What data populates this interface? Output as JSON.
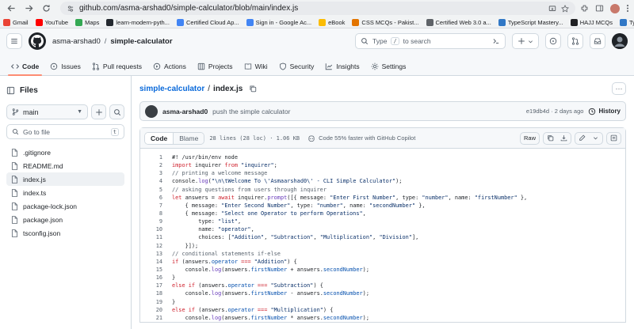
{
  "browser": {
    "url": "github.com/asma-arshad0/simple-calculator/blob/main/index.js",
    "bookmarks": [
      {
        "label": "Gmail",
        "color": "#ea4335"
      },
      {
        "label": "YouTube",
        "color": "#ff0000"
      },
      {
        "label": "Maps",
        "color": "#34a853"
      },
      {
        "label": "learn-modern-pyth...",
        "color": "#24292f"
      },
      {
        "label": "Certified Cloud Ap...",
        "color": "#4285f4"
      },
      {
        "label": "Sign in - Google Ac...",
        "color": "#4285f4"
      },
      {
        "label": "eBook",
        "color": "#fbbc04"
      },
      {
        "label": "CSS MCQs - Pakist...",
        "color": "#e37400"
      },
      {
        "label": "Certified Web 3.0 a...",
        "color": "#5f6368"
      },
      {
        "label": "TypeScript Mastery...",
        "color": "#3178c6"
      },
      {
        "label": "HAJJ MCQs",
        "color": "#202124"
      },
      {
        "label": "TypeScript Assign...",
        "color": "#3178c6"
      }
    ]
  },
  "header": {
    "owner": "asma-arshad0",
    "separator": "/",
    "repo": "simple-calculator",
    "search_placeholder_pre": "Type",
    "search_kbd": "/",
    "search_placeholder_post": "to search"
  },
  "tabs": [
    {
      "label": "Code",
      "icon": "code-icon",
      "active": true
    },
    {
      "label": "Issues",
      "icon": "issue-icon"
    },
    {
      "label": "Pull requests",
      "icon": "pull-request-icon"
    },
    {
      "label": "Actions",
      "icon": "play-icon"
    },
    {
      "label": "Projects",
      "icon": "table-icon"
    },
    {
      "label": "Wiki",
      "icon": "book-icon"
    },
    {
      "label": "Security",
      "icon": "shield-icon"
    },
    {
      "label": "Insights",
      "icon": "graph-icon"
    },
    {
      "label": "Settings",
      "icon": "gear-icon"
    }
  ],
  "sidebar": {
    "title": "Files",
    "branch": "main",
    "goto_placeholder": "Go to file",
    "goto_kbd": "t",
    "files": [
      {
        "name": ".gitignore"
      },
      {
        "name": "README.md"
      },
      {
        "name": "index.js",
        "active": true
      },
      {
        "name": "index.ts"
      },
      {
        "name": "package-lock.json"
      },
      {
        "name": "package.json"
      },
      {
        "name": "tsconfig.json"
      }
    ]
  },
  "file": {
    "repo_link": "simple-calculator",
    "sep": "/",
    "name": "index.js",
    "commit_user": "asma-arshad0",
    "commit_message": "push the simple calculator",
    "commit_meta": "e19db4d · 2 days ago",
    "history_label": "History",
    "tab_code": "Code",
    "tab_blame": "Blame",
    "info": "28 lines (28 loc) · 1.06 KB",
    "copilot": "Code 55% faster with GitHub Copilot",
    "raw_label": "Raw"
  },
  "code_lines": [
    [
      {
        "t": "#! /usr/bin/env node",
        "c": "src"
      }
    ],
    [
      {
        "t": "import",
        "c": "kw"
      },
      {
        "t": " inquirer ",
        "c": "src"
      },
      {
        "t": "from",
        "c": "kw"
      },
      {
        "t": " ",
        "c": "src"
      },
      {
        "t": "\"inquirer\"",
        "c": "str"
      },
      {
        "t": ";",
        "c": "src"
      }
    ],
    [
      {
        "t": "// printing a welcome message",
        "c": "com"
      }
    ],
    [
      {
        "t": "console.",
        "c": "src"
      },
      {
        "t": "log",
        "c": "fn"
      },
      {
        "t": "(",
        "c": "src"
      },
      {
        "t": "\"\\n\\tWelcome To \\'Asmaarshad0\\' - CLI Simple Calculator\"",
        "c": "str"
      },
      {
        "t": ");",
        "c": "src"
      }
    ],
    [
      {
        "t": "// asking questions from users through inquirer",
        "c": "com"
      }
    ],
    [
      {
        "t": "let",
        "c": "kw"
      },
      {
        "t": " answers = ",
        "c": "src"
      },
      {
        "t": "await",
        "c": "kw"
      },
      {
        "t": " inquirer.",
        "c": "src"
      },
      {
        "t": "prompt",
        "c": "fn"
      },
      {
        "t": "([{ message: ",
        "c": "src"
      },
      {
        "t": "\"Enter First Number\"",
        "c": "str"
      },
      {
        "t": ", type: ",
        "c": "src"
      },
      {
        "t": "\"number\"",
        "c": "str"
      },
      {
        "t": ", name: ",
        "c": "src"
      },
      {
        "t": "\"firstNumber\"",
        "c": "str"
      },
      {
        "t": " },",
        "c": "src"
      }
    ],
    [
      {
        "t": "    { message: ",
        "c": "src"
      },
      {
        "t": "\"Enter Second Number\"",
        "c": "str"
      },
      {
        "t": ", type: ",
        "c": "src"
      },
      {
        "t": "\"number\"",
        "c": "str"
      },
      {
        "t": ", name: ",
        "c": "src"
      },
      {
        "t": "\"secondNumber\"",
        "c": "str"
      },
      {
        "t": " },",
        "c": "src"
      }
    ],
    [
      {
        "t": "    { message: ",
        "c": "src"
      },
      {
        "t": "\"Select one Operator to perform Operations\"",
        "c": "str"
      },
      {
        "t": ",",
        "c": "src"
      }
    ],
    [
      {
        "t": "        type: ",
        "c": "src"
      },
      {
        "t": "\"list\"",
        "c": "str"
      },
      {
        "t": ",",
        "c": "src"
      }
    ],
    [
      {
        "t": "        name: ",
        "c": "src"
      },
      {
        "t": "\"operator\"",
        "c": "str"
      },
      {
        "t": ",",
        "c": "src"
      }
    ],
    [
      {
        "t": "        choices: [",
        "c": "src"
      },
      {
        "t": "\"Addition\"",
        "c": "str"
      },
      {
        "t": ", ",
        "c": "src"
      },
      {
        "t": "\"Subtraction\"",
        "c": "str"
      },
      {
        "t": ", ",
        "c": "src"
      },
      {
        "t": "\"Multiplication\"",
        "c": "str"
      },
      {
        "t": ", ",
        "c": "src"
      },
      {
        "t": "\"Division\"",
        "c": "str"
      },
      {
        "t": "],",
        "c": "src"
      }
    ],
    [
      {
        "t": "    }]);",
        "c": "src"
      }
    ],
    [
      {
        "t": "// conditional statements if-else",
        "c": "com"
      }
    ],
    [
      {
        "t": "if",
        "c": "kw"
      },
      {
        "t": " (answers.",
        "c": "src"
      },
      {
        "t": "operator",
        "c": "prop"
      },
      {
        "t": " === ",
        "c": "kw"
      },
      {
        "t": "\"Addition\"",
        "c": "str"
      },
      {
        "t": ") {",
        "c": "src"
      }
    ],
    [
      {
        "t": "    console.",
        "c": "src"
      },
      {
        "t": "log",
        "c": "fn"
      },
      {
        "t": "(answers.",
        "c": "src"
      },
      {
        "t": "firstNumber",
        "c": "prop"
      },
      {
        "t": " + answers.",
        "c": "src"
      },
      {
        "t": "secondNumber",
        "c": "prop"
      },
      {
        "t": ");",
        "c": "src"
      }
    ],
    [
      {
        "t": "}",
        "c": "src"
      }
    ],
    [
      {
        "t": "else if",
        "c": "kw"
      },
      {
        "t": " (answers.",
        "c": "src"
      },
      {
        "t": "operator",
        "c": "prop"
      },
      {
        "t": " === ",
        "c": "kw"
      },
      {
        "t": "\"Subtraction\"",
        "c": "str"
      },
      {
        "t": ") {",
        "c": "src"
      }
    ],
    [
      {
        "t": "    console.",
        "c": "src"
      },
      {
        "t": "log",
        "c": "fn"
      },
      {
        "t": "(answers.",
        "c": "src"
      },
      {
        "t": "firstNumber",
        "c": "prop"
      },
      {
        "t": " - answers.",
        "c": "src"
      },
      {
        "t": "secondNumber",
        "c": "prop"
      },
      {
        "t": ");",
        "c": "src"
      }
    ],
    [
      {
        "t": "}",
        "c": "src"
      }
    ],
    [
      {
        "t": "else if",
        "c": "kw"
      },
      {
        "t": " (answers.",
        "c": "src"
      },
      {
        "t": "operator",
        "c": "prop"
      },
      {
        "t": " === ",
        "c": "kw"
      },
      {
        "t": "\"Multiplication\"",
        "c": "str"
      },
      {
        "t": ") {",
        "c": "src"
      }
    ],
    [
      {
        "t": "    console.",
        "c": "src"
      },
      {
        "t": "log",
        "c": "fn"
      },
      {
        "t": "(answers.",
        "c": "src"
      },
      {
        "t": "firstNumber",
        "c": "prop"
      },
      {
        "t": " * answers.",
        "c": "src"
      },
      {
        "t": "secondNumber",
        "c": "prop"
      },
      {
        "t": ");",
        "c": "src"
      }
    ]
  ]
}
